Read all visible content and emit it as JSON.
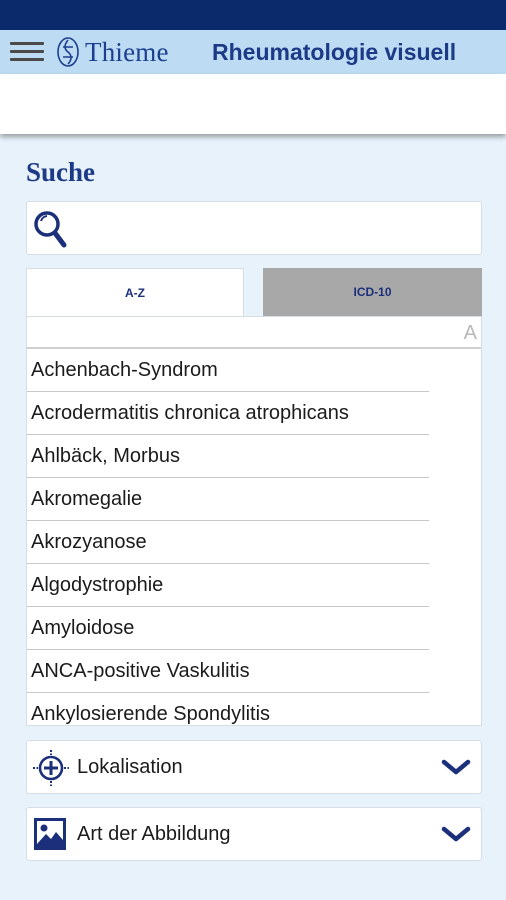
{
  "app_bar": {
    "brand": "Thieme",
    "title": "Rheumatologie visuell"
  },
  "search": {
    "heading": "Suche",
    "placeholder": "",
    "value": ""
  },
  "tabs": [
    {
      "label": "A-Z",
      "active": true
    },
    {
      "label": "ICD-10",
      "active": false
    }
  ],
  "list": {
    "current_letter": "A",
    "items": [
      "Achenbach-Syndrom",
      "Acrodermatitis chronica atrophicans",
      "Ahlbäck, Morbus",
      "Akromegalie",
      "Akrozyanose",
      "Algodystrophie",
      "Amyloidose",
      "ANCA-positive Vaskulitis",
      "Ankylosierende Spondylitis"
    ]
  },
  "filters": {
    "lokalisation": {
      "label": "Lokalisation",
      "icon": "crosshair-icon"
    },
    "abbildung": {
      "label": "Art der Abbildung",
      "icon": "image-icon"
    }
  },
  "colors": {
    "status_bar": "#0b2a6b",
    "app_bar": "#bddcf3",
    "background": "#e8f2fb",
    "brand_blue": "#1c3a86",
    "tab_inactive": "#a8a8a8"
  }
}
